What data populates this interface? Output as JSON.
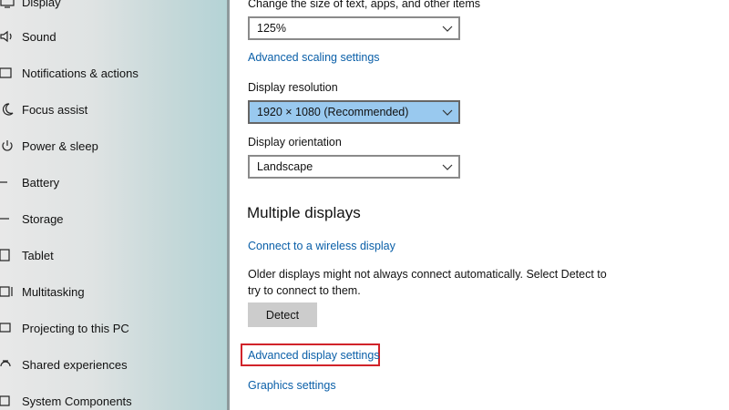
{
  "sidebar": {
    "items": [
      {
        "label": "Display",
        "icon": "monitor-icon"
      },
      {
        "label": "Sound",
        "icon": "speaker-icon"
      },
      {
        "label": "Notifications & actions",
        "icon": "notification-icon"
      },
      {
        "label": "Focus assist",
        "icon": "moon-icon"
      },
      {
        "label": "Power & sleep",
        "icon": "power-icon"
      },
      {
        "label": "Battery",
        "icon": "battery-icon"
      },
      {
        "label": "Storage",
        "icon": "storage-icon"
      },
      {
        "label": "Tablet",
        "icon": "tablet-icon"
      },
      {
        "label": "Multitasking",
        "icon": "multitasking-icon"
      },
      {
        "label": "Projecting to this PC",
        "icon": "projector-icon"
      },
      {
        "label": "Shared experiences",
        "icon": "share-icon"
      },
      {
        "label": "System Components",
        "icon": "components-icon"
      }
    ]
  },
  "scale": {
    "label": "Change the size of text, apps, and other items",
    "value": "125%",
    "advanced_link": "Advanced scaling settings"
  },
  "resolution": {
    "label": "Display resolution",
    "value": "1920 × 1080 (Recommended)"
  },
  "orientation": {
    "label": "Display orientation",
    "value": "Landscape"
  },
  "multiple": {
    "heading": "Multiple displays",
    "wireless_link": "Connect to a wireless display",
    "description": "Older displays might not always connect automatically. Select Detect to try to connect to them.",
    "detect_label": "Detect"
  },
  "links": {
    "advanced_display": "Advanced display settings",
    "graphics": "Graphics settings"
  },
  "colors": {
    "link": "#0a5fa8",
    "selected_dropdown": "#99c9ef",
    "highlight_box": "#d1232a",
    "button": "#cccccc"
  }
}
